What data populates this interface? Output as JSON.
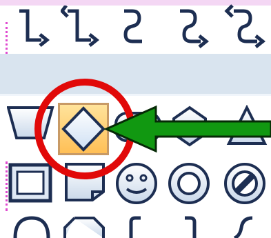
{
  "gallery": {
    "rows": [
      {
        "name": "connectors",
        "items": [
          "elbow-arrow-connector-icon",
          "elbow-double-arrow-connector-icon",
          "curved-connector-icon",
          "curved-arrow-connector-icon",
          "curved-double-arrow-connector-icon"
        ]
      },
      {
        "name": "flowchart-row-1",
        "items": [
          "manual-operation-shape",
          "decision-shape",
          "terminator-shape",
          "preparation-shape",
          "extract-shape"
        ]
      },
      {
        "name": "flowchart-row-2",
        "items": [
          "bevel-shape",
          "folded-corner-shape",
          "smiley-face-shape",
          "donut-shape",
          "no-symbol-shape"
        ]
      },
      {
        "name": "flowchart-row-3",
        "items": [
          "arc-shape",
          "octagon-shape",
          "left-bracket-shape",
          "right-bracket-shape",
          "curve-shape"
        ]
      }
    ],
    "selected": "decision-shape"
  },
  "annotations": {
    "circle_color": "#e10909",
    "arrow_color": "#119811"
  },
  "colors": {
    "icon_stroke": "#1d2e52",
    "band": "#d9e4ef",
    "highlight_top": "#ffe39b",
    "highlight_bottom": "#ffbf56",
    "dotted": "#e04ad0"
  }
}
